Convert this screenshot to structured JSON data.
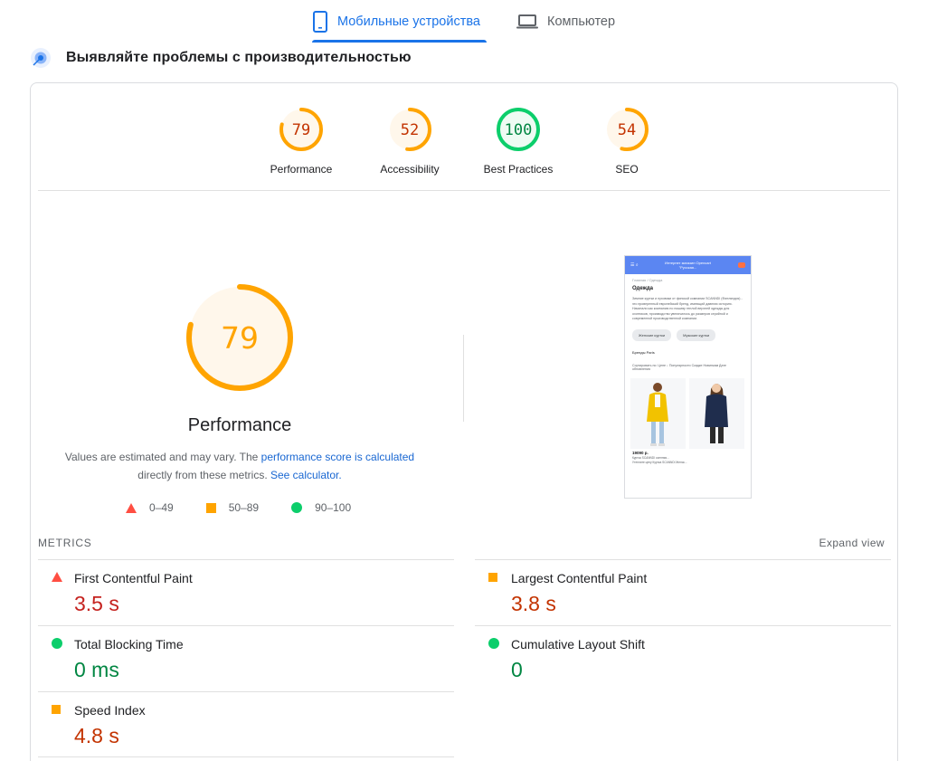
{
  "tabs": [
    {
      "label": "Мобильные устройства",
      "icon": "smartphone-icon",
      "active": true
    },
    {
      "label": "Компьютер",
      "icon": "laptop-icon",
      "active": false
    }
  ],
  "heading": {
    "text": "Выявляйте проблемы с производительностью"
  },
  "scores": [
    {
      "label": "Performance",
      "value": "79",
      "score": 79,
      "color": "#ffa400"
    },
    {
      "label": "Accessibility",
      "value": "52",
      "score": 52,
      "color": "#ffa400"
    },
    {
      "label": "Best Practices",
      "value": "100",
      "score": 100,
      "color": "#0cce6b"
    },
    {
      "label": "SEO",
      "value": "54",
      "score": 54,
      "color": "#ffa400"
    }
  ],
  "main": {
    "score": "79",
    "score_value": 79,
    "title": "Performance",
    "note_part1": "Values are estimated and may vary. The ",
    "note_link1": "performance score is calculated",
    "note_part2": " directly from these metrics. ",
    "note_link2": "See calculator."
  },
  "legend": [
    {
      "shape": "triangle",
      "range": "0–49",
      "color": "#ff4e42"
    },
    {
      "shape": "square",
      "range": "50–89",
      "color": "#ffa400"
    },
    {
      "shape": "circle",
      "range": "90–100",
      "color": "#0cce6b"
    }
  ],
  "thumbnail": {
    "header": "Интернет магазин Opencart \"Русская...",
    "crumb": "Главная / Одежда",
    "title": "Одежда",
    "text": "Зимние куртки и пуховики от финской компании SCANNDI (Финляндия) - это проверенный европейский бренд, имеющий давнюю историю. Начинали как компанию по пошиву теплой верхней одежды для охотников, производство увеличилось до размеров серийной и современной производственной компании.",
    "chip1": "Женские куртки",
    "chip2": "Мужские куртки",
    "brands": "Бренды   Paris",
    "sort": "Сортировать по:  Цене ↓  Популярности  Скидке  Новинкам  Дате обновления",
    "price": "19090 р.",
    "caption1": "Куртка SCANNDI осенняя...",
    "caption2": "Утеплите цену  Куртка SCANNDI Женск..."
  },
  "metrics_header": {
    "title": "METRICS",
    "expand": "Expand view"
  },
  "metrics": [
    {
      "name": "First Contentful Paint",
      "value": "3.5 s",
      "status": "red"
    },
    {
      "name": "Largest Contentful Paint",
      "value": "3.8 s",
      "status": "orange"
    },
    {
      "name": "Total Blocking Time",
      "value": "0 ms",
      "status": "green"
    },
    {
      "name": "Cumulative Layout Shift",
      "value": "0",
      "status": "green"
    },
    {
      "name": "Speed Index",
      "value": "4.8 s",
      "status": "orange"
    }
  ],
  "colors": {
    "accent": "#1a73e8",
    "fail": "#ff4e42",
    "average": "#ffa400",
    "pass": "#0cce6b"
  }
}
